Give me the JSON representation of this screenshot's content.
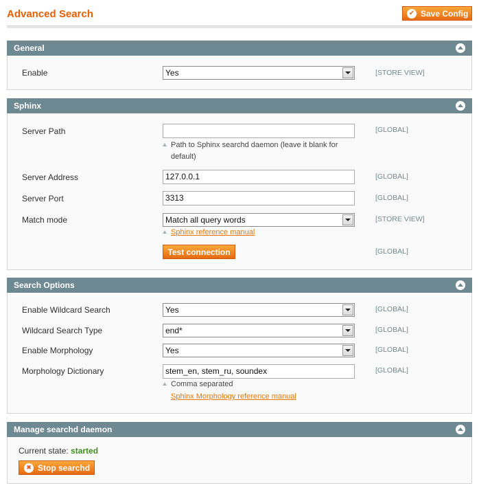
{
  "header": {
    "title": "Advanced Search",
    "save_label": "Save Config"
  },
  "general": {
    "title": "General",
    "enable": {
      "label": "Enable",
      "value": "Yes",
      "scope": "[STORE VIEW]"
    }
  },
  "sphinx": {
    "title": "Sphinx",
    "server_path": {
      "label": "Server Path",
      "value": "",
      "scope": "[GLOBAL]",
      "note_line1": "Path to Sphinx searchd daemon (leave it blank for",
      "note_line2": "default)"
    },
    "server_address": {
      "label": "Server Address",
      "value": "127.0.0.1",
      "scope": "[GLOBAL]"
    },
    "server_port": {
      "label": "Server Port",
      "value": "3313",
      "scope": "[GLOBAL]"
    },
    "match_mode": {
      "label": "Match mode",
      "value": "Match all query words",
      "scope": "[STORE VIEW]",
      "link": "Sphinx reference manual"
    },
    "test_connection": {
      "label": "Test connection",
      "scope": "[GLOBAL]"
    }
  },
  "search_options": {
    "title": "Search Options",
    "enable_wildcard": {
      "label": "Enable Wildcard Search",
      "value": "Yes",
      "scope": "[GLOBAL]"
    },
    "wildcard_type": {
      "label": "Wildcard Search Type",
      "value": "end*",
      "scope": "[GLOBAL]"
    },
    "enable_morphology": {
      "label": "Enable Morphology",
      "value": "Yes",
      "scope": "[GLOBAL]"
    },
    "morphology_dictionary": {
      "label": "Morphology Dictionary",
      "value": "stem_en, stem_ru, soundex",
      "scope": "[GLOBAL]",
      "note": "Comma separated",
      "link": "Sphinx Morphology reference manual"
    }
  },
  "daemon": {
    "title": "Manage searchd daemon",
    "state_label": "Current state:",
    "state_value": "started",
    "stop_label": "Stop searchd"
  },
  "colors": {
    "accent": "#eb5e00",
    "section_header": "#6f8992",
    "state_ok": "#3d8f1b"
  }
}
